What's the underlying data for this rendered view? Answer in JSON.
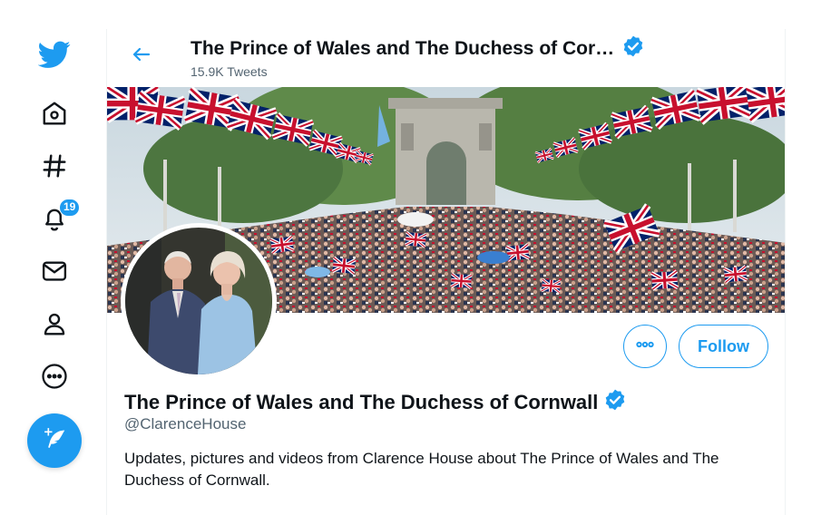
{
  "nav": {
    "items": [
      {
        "icon": "twitter-logo-icon"
      },
      {
        "icon": "home-icon"
      },
      {
        "icon": "explore-hashtag-icon"
      },
      {
        "icon": "notifications-bell-icon",
        "badge": "19"
      },
      {
        "icon": "messages-envelope-icon"
      },
      {
        "icon": "profile-person-icon"
      },
      {
        "icon": "more-ellipsis-icon"
      }
    ],
    "compose_icon": "compose-tweet-icon"
  },
  "header": {
    "title": "The Prince of Wales and The Duchess of Cor…",
    "tweet_count": "15.9K Tweets"
  },
  "profile": {
    "name": "The Prince of Wales and The Duchess of Cornwall",
    "handle": "@ClarenceHouse",
    "bio": "Updates, pictures and videos from Clarence House about The Prince of Wales and The Duchess of Cornwall.",
    "verified": true,
    "follow_label": "Follow"
  },
  "colors": {
    "accent": "#1d9bf0",
    "text": "#0f1419",
    "secondary_text": "#536471"
  }
}
